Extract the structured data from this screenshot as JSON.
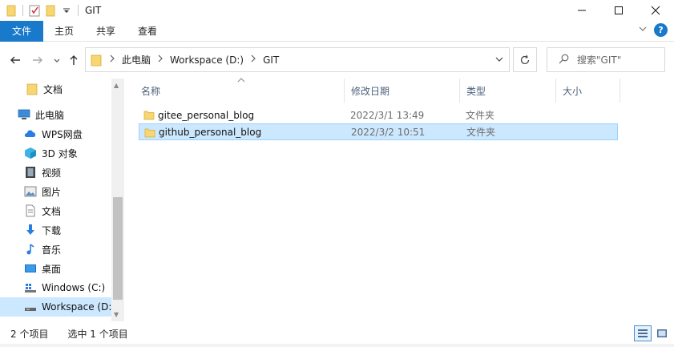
{
  "window": {
    "title": "GIT",
    "controls": [
      "minimize-icon",
      "maximize-icon",
      "close-icon"
    ]
  },
  "ribbon": {
    "tabs": [
      "文件",
      "主页",
      "共享",
      "查看"
    ],
    "help_icon": "?"
  },
  "address": {
    "crumbs": [
      "此电脑",
      "Workspace (D:)",
      "GIT"
    ],
    "search_placeholder": "搜索\"GIT\""
  },
  "nav": {
    "items": [
      {
        "label": "文档",
        "icon": "folder-icon"
      },
      {
        "label": "此电脑",
        "icon": "computer-icon"
      },
      {
        "label": "WPS网盘",
        "icon": "cloud-icon"
      },
      {
        "label": "3D 对象",
        "icon": "cube-icon"
      },
      {
        "label": "视频",
        "icon": "video-icon"
      },
      {
        "label": "图片",
        "icon": "picture-icon"
      },
      {
        "label": "文档",
        "icon": "document-icon"
      },
      {
        "label": "下载",
        "icon": "download-icon"
      },
      {
        "label": "音乐",
        "icon": "music-icon"
      },
      {
        "label": "桌面",
        "icon": "desktop-icon"
      },
      {
        "label": "Windows (C:)",
        "icon": "drive-c-icon"
      },
      {
        "label": "Workspace (D:",
        "icon": "drive-d-icon"
      }
    ]
  },
  "columns": [
    "名称",
    "修改日期",
    "类型",
    "大小"
  ],
  "files": [
    {
      "name": "gitee_personal_blog",
      "date": "2022/3/1 13:49",
      "type": "文件夹",
      "size": ""
    },
    {
      "name": "github_personal_blog",
      "date": "2022/3/2 10:51",
      "type": "文件夹",
      "size": ""
    }
  ],
  "status": {
    "count": "2 个项目",
    "selected": "选中 1 个项目"
  },
  "colors": {
    "accent": "#1979ca",
    "selection": "#cce8ff",
    "selection_border": "#99d1ff",
    "folder": "#f7d774"
  }
}
